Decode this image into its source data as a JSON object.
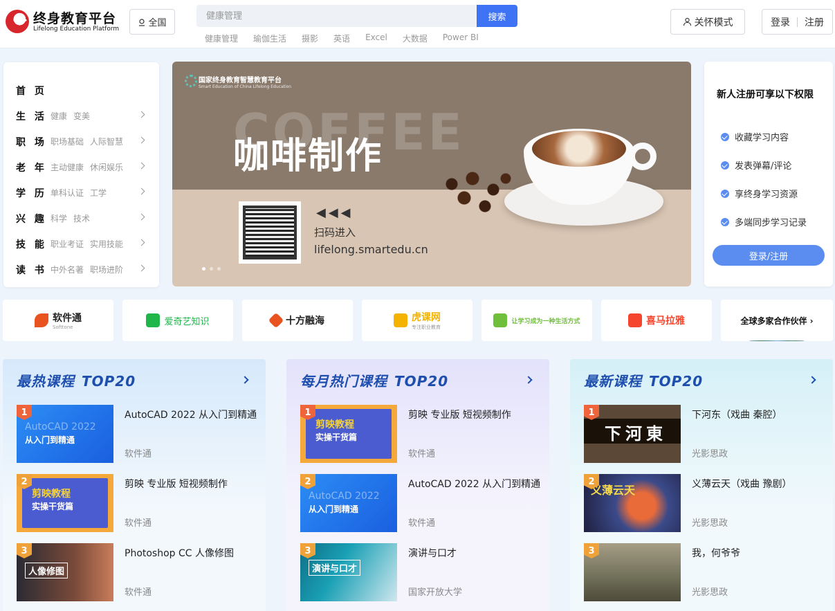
{
  "header": {
    "logo_cn": "终身教育平台",
    "logo_en": "Lifelong Education Platform",
    "region": "全国",
    "search_placeholder": "健康管理",
    "search_button": "搜索",
    "hot_keywords": [
      "健康管理",
      "瑜伽生活",
      "摄影",
      "英语",
      "Excel",
      "大数据",
      "Power BI"
    ],
    "care_mode": "关怀模式",
    "login": "登录",
    "register": "注册"
  },
  "categories": [
    {
      "title": "首 页",
      "subs": []
    },
    {
      "title": "生 活",
      "subs": [
        "健康",
        "变美"
      ]
    },
    {
      "title": "职 场",
      "subs": [
        "职场基础",
        "人际智慧"
      ]
    },
    {
      "title": "老 年",
      "subs": [
        "主动健康",
        "休闲娱乐"
      ]
    },
    {
      "title": "学 历",
      "subs": [
        "单科认证",
        "工学"
      ]
    },
    {
      "title": "兴 趣",
      "subs": [
        "科学",
        "技术"
      ]
    },
    {
      "title": "技 能",
      "subs": [
        "职业考证",
        "实用技能"
      ]
    },
    {
      "title": "读 书",
      "subs": [
        "中外名著",
        "职场进阶"
      ]
    }
  ],
  "banner": {
    "brand": "国家终身教育智慧教育平台",
    "brand_en": "Smart Education of China Lifelong Education",
    "bg_word": "COFFEE",
    "title": "咖啡制作",
    "arrows": "◀◀◀",
    "scan": "扫码进入",
    "url": "lifelong.smartedu.cn"
  },
  "perks": {
    "title": "新人注册可享以下权限",
    "items": [
      "收藏学习内容",
      "发表弹幕/评论",
      "享终身学习资源",
      "多端同步学习记录"
    ],
    "button": "登录/注册"
  },
  "partners": [
    {
      "name": "软件通",
      "sub": "Softtone",
      "color": "#e8531f"
    },
    {
      "name": "爱奇艺知识",
      "sub": "",
      "color": "#1fb64a"
    },
    {
      "name": "十方融海",
      "sub": "",
      "color": "#e8531f"
    },
    {
      "name": "虎课网",
      "sub": "专注职业教育",
      "color": "#f3b300"
    },
    {
      "name": "让学习成为一种生活方式",
      "sub": "",
      "color": "#6fbf3a"
    },
    {
      "name": "喜马拉雅",
      "sub": "",
      "color": "#f5452d"
    }
  ],
  "partner_more": "全球多家合作伙伴 ›",
  "columns": [
    {
      "title": "最热课程",
      "tag": "TOP20",
      "courses": [
        {
          "rank": "1",
          "title": "AutoCAD 2022 从入门到精通",
          "source": "软件通",
          "thumb_big": "AutoCAD 2022",
          "thumb_small": "从入门到精通"
        },
        {
          "rank": "2",
          "title": "剪映 专业版 短视频制作",
          "source": "软件通",
          "thumb_big": "剪映教程",
          "thumb_small": "实操干货篇"
        },
        {
          "rank": "3",
          "title": "Photoshop CC 人像修图",
          "source": "软件通",
          "thumb_big": "人像修图",
          "thumb_small": ""
        }
      ]
    },
    {
      "title": "每月热门课程",
      "tag": "TOP20",
      "courses": [
        {
          "rank": "1",
          "title": "剪映 专业版 短视频制作",
          "source": "软件通",
          "thumb_big": "剪映教程",
          "thumb_small": "实操干货篇"
        },
        {
          "rank": "2",
          "title": "AutoCAD 2022 从入门到精通",
          "source": "软件通",
          "thumb_big": "AutoCAD 2022",
          "thumb_small": "从入门到精通"
        },
        {
          "rank": "3",
          "title": "演讲与口才",
          "source": "国家开放大学",
          "thumb_big": "演讲与口才",
          "thumb_small": ""
        }
      ]
    },
    {
      "title": "最新课程",
      "tag": "TOP20",
      "courses": [
        {
          "rank": "1",
          "title": "下河东（戏曲 秦腔）",
          "source": "光影思政",
          "thumb_big": "下河東",
          "thumb_small": ""
        },
        {
          "rank": "2",
          "title": "义薄云天（戏曲 豫剧）",
          "source": "光影思政",
          "thumb_big": "义薄云天",
          "thumb_small": ""
        },
        {
          "rank": "3",
          "title": "我，何爷爷",
          "source": "光影思政",
          "thumb_big": "",
          "thumb_small": ""
        }
      ]
    }
  ]
}
